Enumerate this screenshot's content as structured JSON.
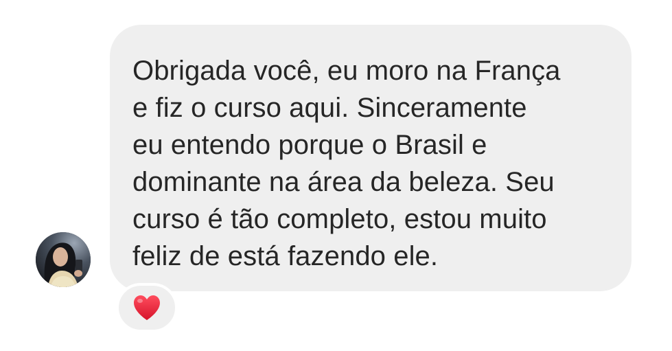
{
  "message": {
    "lines": [
      "Obrigada você, eu moro na França",
      "e fiz o curso aqui. Sinceramente",
      "eu entendo porque o Brasil e",
      "dominante na área da beleza. Seu",
      "curso é tão completo, estou muito",
      "feliz de está fazendo ele."
    ],
    "bubble_color": "#efefef",
    "text_color": "#262626"
  },
  "reaction": {
    "icon": "heart-icon",
    "color": "#e0245e"
  },
  "sender": {
    "avatar_icon": "avatar"
  }
}
